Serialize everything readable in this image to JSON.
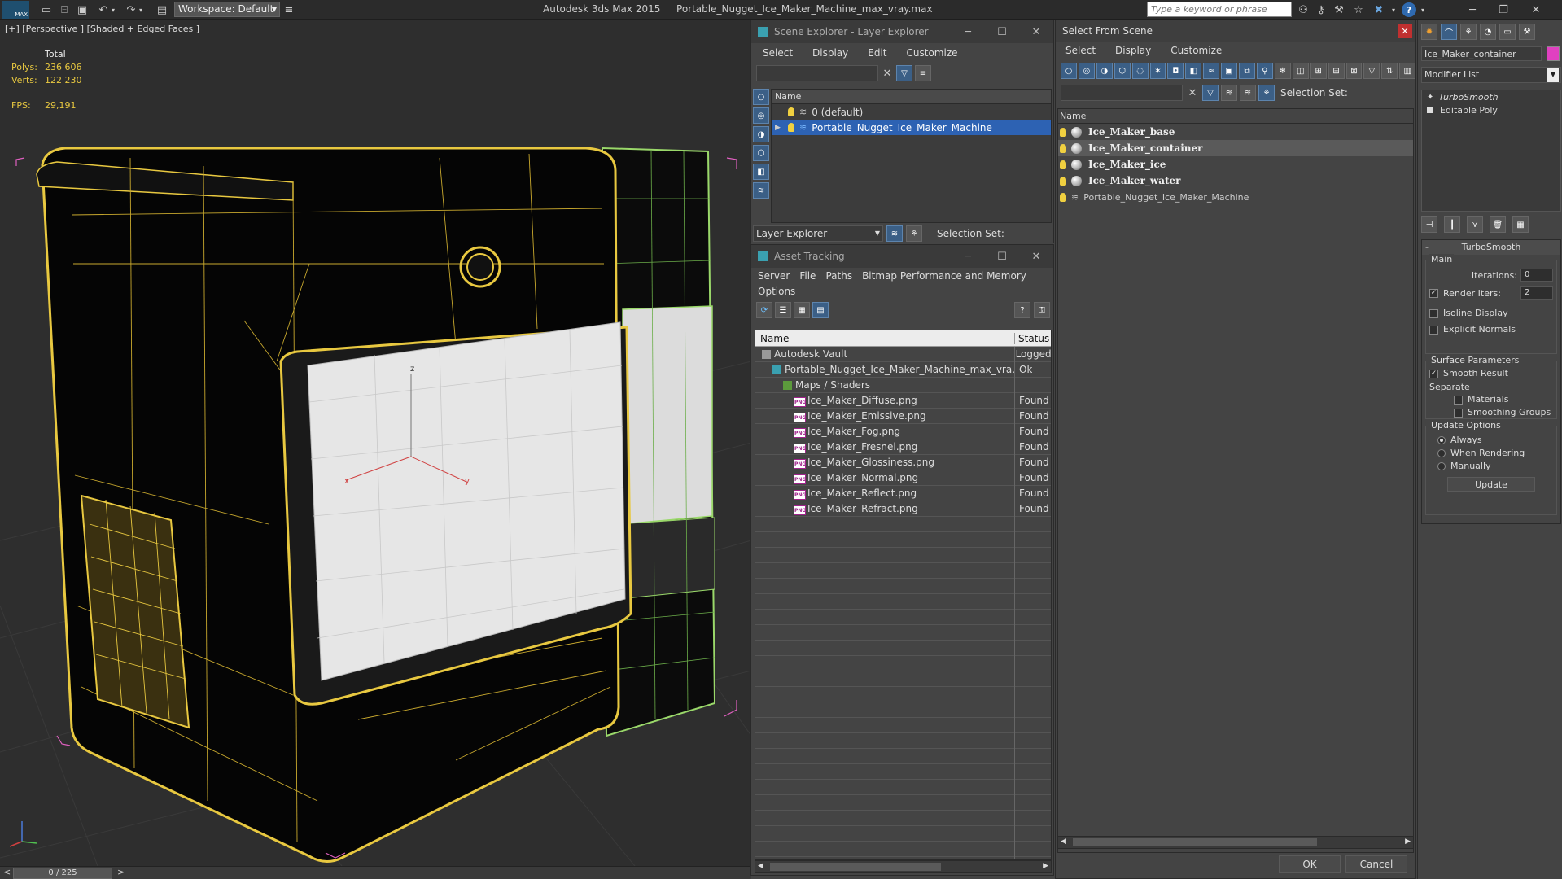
{
  "titlebar": {
    "logo": "MAX",
    "workspace": "Workspace: Default",
    "app_title": "Autodesk 3ds Max  2015",
    "file_title": "Portable_Nugget_Ice_Maker_Machine_max_vray.max",
    "search_placeholder": "Type a keyword or phrase"
  },
  "viewport": {
    "label": "[+] [Perspective ] [Shaded + Edged Faces ]",
    "stats_header": "Total",
    "polys_label": "Polys:",
    "polys_value": "236 606",
    "verts_label": "Verts:",
    "verts_value": "122 230",
    "fps_label": "FPS:",
    "fps_value": "29,191",
    "axis_z": "z",
    "axis_x": "x",
    "axis_y": "y"
  },
  "timeline": {
    "frame": "0 / 225",
    "left": "<",
    "right": ">"
  },
  "scene_explorer": {
    "title": "Scene Explorer - Layer Explorer",
    "menu": [
      "Select",
      "Display",
      "Edit",
      "Customize"
    ],
    "col_name": "Name",
    "layers": [
      {
        "name": "0 (default)",
        "selected": false
      },
      {
        "name": "Portable_Nugget_Ice_Maker_Machine",
        "selected": true
      }
    ],
    "footer_label": "Layer Explorer",
    "selection_set": "Selection Set:"
  },
  "asset_tracking": {
    "title": "Asset Tracking",
    "menu": [
      "Server",
      "File",
      "Paths",
      "Bitmap Performance and Memory"
    ],
    "menu2": "Options",
    "col_name": "Name",
    "col_status": "Status",
    "rows": [
      {
        "name": "Autodesk Vault",
        "status": "Logged",
        "indent": 0,
        "icon": "vault-icon"
      },
      {
        "name": "Portable_Nugget_Ice_Maker_Machine_max_vra...",
        "status": "Ok",
        "indent": 1,
        "icon": "max-file-icon"
      },
      {
        "name": "Maps / Shaders",
        "status": "",
        "indent": 2,
        "icon": "maps-icon"
      },
      {
        "name": "Ice_Maker_Diffuse.png",
        "status": "Found",
        "indent": 3,
        "icon": "png-icon"
      },
      {
        "name": "Ice_Maker_Emissive.png",
        "status": "Found",
        "indent": 3,
        "icon": "png-icon"
      },
      {
        "name": "Ice_Maker_Fog.png",
        "status": "Found",
        "indent": 3,
        "icon": "png-icon"
      },
      {
        "name": "Ice_Maker_Fresnel.png",
        "status": "Found",
        "indent": 3,
        "icon": "png-icon"
      },
      {
        "name": "Ice_Maker_Glossiness.png",
        "status": "Found",
        "indent": 3,
        "icon": "png-icon"
      },
      {
        "name": "Ice_Maker_Normal.png",
        "status": "Found",
        "indent": 3,
        "icon": "png-icon"
      },
      {
        "name": "Ice_Maker_Reflect.png",
        "status": "Found",
        "indent": 3,
        "icon": "png-icon"
      },
      {
        "name": "Ice_Maker_Refract.png",
        "status": "Found",
        "indent": 3,
        "icon": "png-icon"
      }
    ],
    "png_tag": "PNG"
  },
  "select_from_scene": {
    "title": "Select From Scene",
    "menu": [
      "Select",
      "Display",
      "Customize"
    ],
    "selection_set": "Selection Set:",
    "col_name": "Name",
    "objects": [
      {
        "name": "Ice_Maker_base",
        "bold": true,
        "selected": false
      },
      {
        "name": "Ice_Maker_container",
        "bold": true,
        "selected": true
      },
      {
        "name": "Ice_Maker_ice",
        "bold": true,
        "selected": false
      },
      {
        "name": "Ice_Maker_water",
        "bold": true,
        "selected": false
      },
      {
        "name": "Portable_Nugget_Ice_Maker_Machine",
        "bold": false,
        "selected": false
      }
    ],
    "ok": "OK",
    "cancel": "Cancel"
  },
  "command_panel": {
    "object_name": "Ice_Maker_container",
    "object_color": "#e040c0",
    "modifier_list": "Modifier List",
    "stack": [
      "TurboSmooth",
      "Editable Poly"
    ],
    "rollout_title": "TurboSmooth",
    "main_label": "Main",
    "iterations_label": "Iterations:",
    "iterations_value": "0",
    "render_iters_label": "Render Iters:",
    "render_iters_value": "2",
    "isoline": "Isoline Display",
    "explicit_normals": "Explicit Normals",
    "surface_params": "Surface Parameters",
    "smooth_result": "Smooth Result",
    "separate": "Separate",
    "materials": "Materials",
    "smoothing_groups": "Smoothing Groups",
    "update_options": "Update Options",
    "always": "Always",
    "when_rendering": "When Rendering",
    "manually": "Manually",
    "update_btn": "Update"
  }
}
